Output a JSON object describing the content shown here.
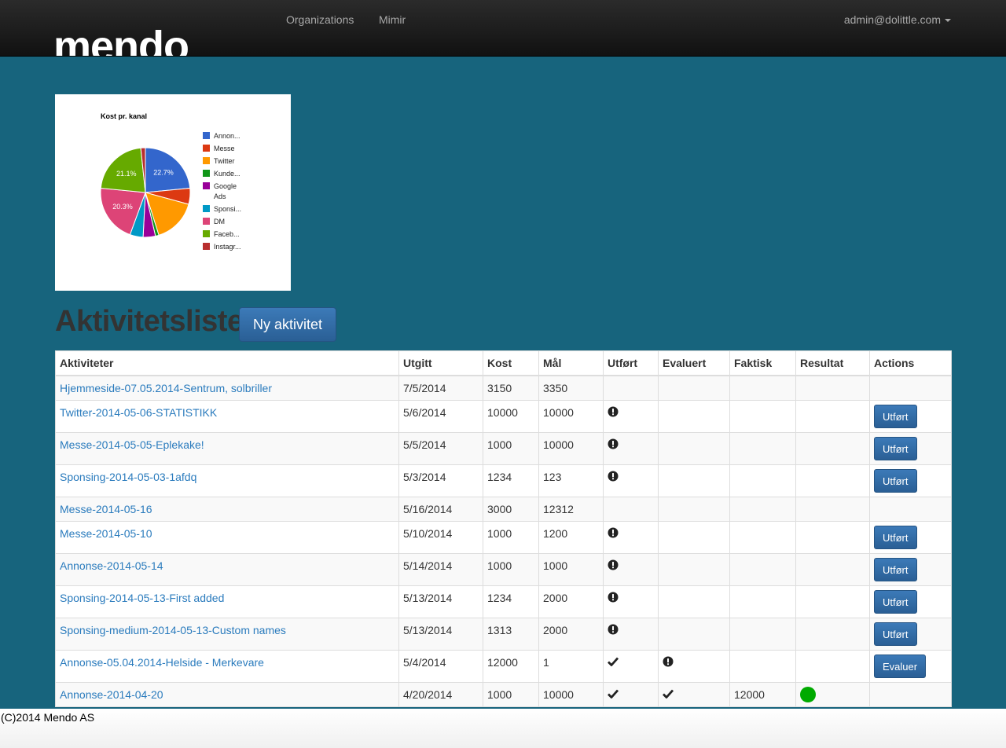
{
  "nav": {
    "brand": "mendo",
    "links": [
      "Organizations",
      "Mimir"
    ],
    "user": "admin@dolittle.com"
  },
  "chart_data": {
    "type": "pie",
    "title": "Kost pr. kanal",
    "legend_position": "right",
    "series": [
      {
        "name": "Annon...",
        "value": 22.7,
        "color": "#3366cc",
        "label": "22.7%"
      },
      {
        "name": "Messe",
        "value": 5.6,
        "color": "#dc3912",
        "label": ""
      },
      {
        "name": "Twitter",
        "value": 15.4,
        "color": "#ff9900",
        "label": ""
      },
      {
        "name": "Kunde...",
        "value": 1.2,
        "color": "#109618",
        "label": ""
      },
      {
        "name": "Google Ads",
        "value": 4.3,
        "color": "#990099",
        "label": ""
      },
      {
        "name": "Sponsi...",
        "value": 4.6,
        "color": "#0099c6",
        "label": ""
      },
      {
        "name": "DM",
        "value": 20.3,
        "color": "#dd4477",
        "label": "20.3%"
      },
      {
        "name": "Faceb...",
        "value": 21.1,
        "color": "#66aa00",
        "label": "21.1%"
      },
      {
        "name": "Instagr...",
        "value": 1.6,
        "color": "#b82e2e",
        "label": ""
      }
    ]
  },
  "page_title": "Aktivitetsliste",
  "new_button": "Ny aktivitet",
  "table": {
    "headers": [
      "Aktiviteter",
      "Utgitt",
      "Kost",
      "Mål",
      "Utført",
      "Evaluert",
      "Faktisk",
      "Resultat",
      "Actions"
    ],
    "rows": [
      {
        "name": "Hjemmeside-07.05.2014-Sentrum, solbriller",
        "utgitt": "7/5/2014",
        "kost": "3150",
        "maal": "3350",
        "utfort": "",
        "evaluert": "",
        "faktisk": "",
        "resultat": "",
        "action": ""
      },
      {
        "name": "Twitter-2014-05-06-STATISTIKK",
        "utgitt": "5/6/2014",
        "kost": "10000",
        "maal": "10000",
        "utfort": "exclamation",
        "evaluert": "",
        "faktisk": "",
        "resultat": "",
        "action": "Utført"
      },
      {
        "name": "Messe-2014-05-05-Eplekake!",
        "utgitt": "5/5/2014",
        "kost": "1000",
        "maal": "10000",
        "utfort": "exclamation",
        "evaluert": "",
        "faktisk": "",
        "resultat": "",
        "action": "Utført"
      },
      {
        "name": "Sponsing-2014-05-03-1afdq",
        "utgitt": "5/3/2014",
        "kost": "1234",
        "maal": "123",
        "utfort": "exclamation",
        "evaluert": "",
        "faktisk": "",
        "resultat": "",
        "action": "Utført"
      },
      {
        "name": "Messe-2014-05-16",
        "utgitt": "5/16/2014",
        "kost": "3000",
        "maal": "12312",
        "utfort": "",
        "evaluert": "",
        "faktisk": "",
        "resultat": "",
        "action": ""
      },
      {
        "name": "Messe-2014-05-10",
        "utgitt": "5/10/2014",
        "kost": "1000",
        "maal": "1200",
        "utfort": "exclamation",
        "evaluert": "",
        "faktisk": "",
        "resultat": "",
        "action": "Utført"
      },
      {
        "name": "Annonse-2014-05-14",
        "utgitt": "5/14/2014",
        "kost": "1000",
        "maal": "1000",
        "utfort": "exclamation",
        "evaluert": "",
        "faktisk": "",
        "resultat": "",
        "action": "Utført"
      },
      {
        "name": "Sponsing-2014-05-13-First added",
        "utgitt": "5/13/2014",
        "kost": "1234",
        "maal": "2000",
        "utfort": "exclamation",
        "evaluert": "",
        "faktisk": "",
        "resultat": "",
        "action": "Utført"
      },
      {
        "name": "Sponsing-medium-2014-05-13-Custom names",
        "utgitt": "5/13/2014",
        "kost": "1313",
        "maal": "2000",
        "utfort": "exclamation",
        "evaluert": "",
        "faktisk": "",
        "resultat": "",
        "action": "Utført"
      },
      {
        "name": "Annonse-05.04.2014-Helside - Merkevare",
        "utgitt": "5/4/2014",
        "kost": "12000",
        "maal": "1",
        "utfort": "check",
        "evaluert": "exclamation",
        "faktisk": "",
        "resultat": "",
        "action": "Evaluer"
      },
      {
        "name": "Annonse-2014-04-20",
        "utgitt": "4/20/2014",
        "kost": "1000",
        "maal": "10000",
        "utfort": "check",
        "evaluert": "check",
        "faktisk": "12000",
        "resultat": "green",
        "action": ""
      }
    ]
  },
  "result_colors": {
    "green": "#00aa00"
  },
  "footer": "(C)2014 Mendo AS"
}
